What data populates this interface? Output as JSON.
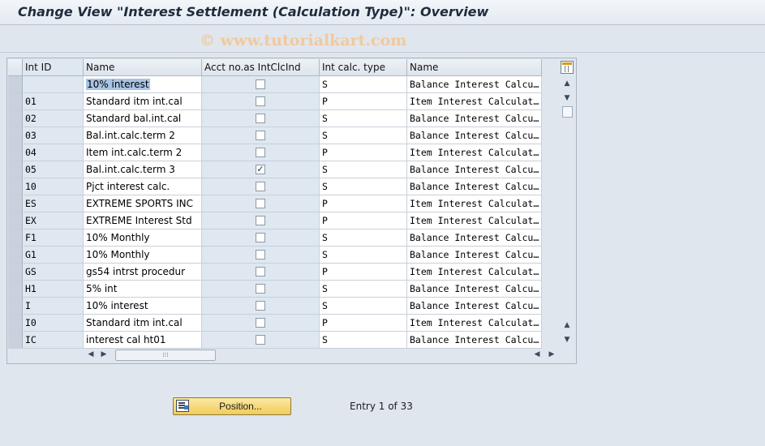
{
  "window": {
    "title": "Change View \"Interest Settlement (Calculation Type)\": Overview",
    "watermark": "© www.tutorialkart.com"
  },
  "table": {
    "columns": [
      {
        "key": "int_id",
        "label": "Int ID"
      },
      {
        "key": "name",
        "label": "Name"
      },
      {
        "key": "acct_no_as_intclcind",
        "label": "Acct no.as IntClcInd"
      },
      {
        "key": "int_calc_type",
        "label": "Int calc. type"
      },
      {
        "key": "type_name",
        "label": "Name"
      }
    ],
    "rows": [
      {
        "int_id": "",
        "name": "10% interest",
        "checked": false,
        "int_calc_type": "S",
        "type_name": "Balance Interest Calcu…"
      },
      {
        "int_id": "01",
        "name": "Standard itm int.cal",
        "checked": false,
        "int_calc_type": "P",
        "type_name": "Item Interest Calculat…"
      },
      {
        "int_id": "02",
        "name": "Standard bal.int.cal",
        "checked": false,
        "int_calc_type": "S",
        "type_name": "Balance Interest Calcu…"
      },
      {
        "int_id": "03",
        "name": "Bal.int.calc.term 2",
        "checked": false,
        "int_calc_type": "S",
        "type_name": "Balance Interest Calcu…"
      },
      {
        "int_id": "04",
        "name": "Item int.calc.term 2",
        "checked": false,
        "int_calc_type": "P",
        "type_name": "Item Interest Calculat…"
      },
      {
        "int_id": "05",
        "name": "Bal.int.calc.term 3",
        "checked": true,
        "int_calc_type": "S",
        "type_name": "Balance Interest Calcu…"
      },
      {
        "int_id": "10",
        "name": "Pjct interest calc.",
        "checked": false,
        "int_calc_type": "S",
        "type_name": "Balance Interest Calcu…"
      },
      {
        "int_id": "ES",
        "name": "EXTREME SPORTS INC",
        "checked": false,
        "int_calc_type": "P",
        "type_name": "Item Interest Calculat…"
      },
      {
        "int_id": "EX",
        "name": "EXTREME Interest Std",
        "checked": false,
        "int_calc_type": "P",
        "type_name": "Item Interest Calculat…"
      },
      {
        "int_id": "F1",
        "name": "10% Monthly",
        "checked": false,
        "int_calc_type": "S",
        "type_name": "Balance Interest Calcu…"
      },
      {
        "int_id": "G1",
        "name": "10% Monthly",
        "checked": false,
        "int_calc_type": "S",
        "type_name": "Balance Interest Calcu…"
      },
      {
        "int_id": "GS",
        "name": "gs54 intrst procedur",
        "checked": false,
        "int_calc_type": "P",
        "type_name": "Item Interest Calculat…"
      },
      {
        "int_id": "H1",
        "name": "5% int",
        "checked": false,
        "int_calc_type": "S",
        "type_name": "Balance Interest Calcu…"
      },
      {
        "int_id": "I",
        "name": "10% interest",
        "checked": false,
        "int_calc_type": "S",
        "type_name": "Balance Interest Calcu…"
      },
      {
        "int_id": "I0",
        "name": "Standard itm int.cal",
        "checked": false,
        "int_calc_type": "P",
        "type_name": "Item Interest Calculat…"
      },
      {
        "int_id": "IC",
        "name": "interest cal ht01",
        "checked": false,
        "int_calc_type": "S",
        "type_name": "Balance Interest Calcu…"
      }
    ]
  },
  "footer": {
    "position_button": "Position...",
    "entry_info": "Entry 1 of 33"
  },
  "icons": {
    "table_settings": "table-settings-icon",
    "position": "position-icon"
  }
}
